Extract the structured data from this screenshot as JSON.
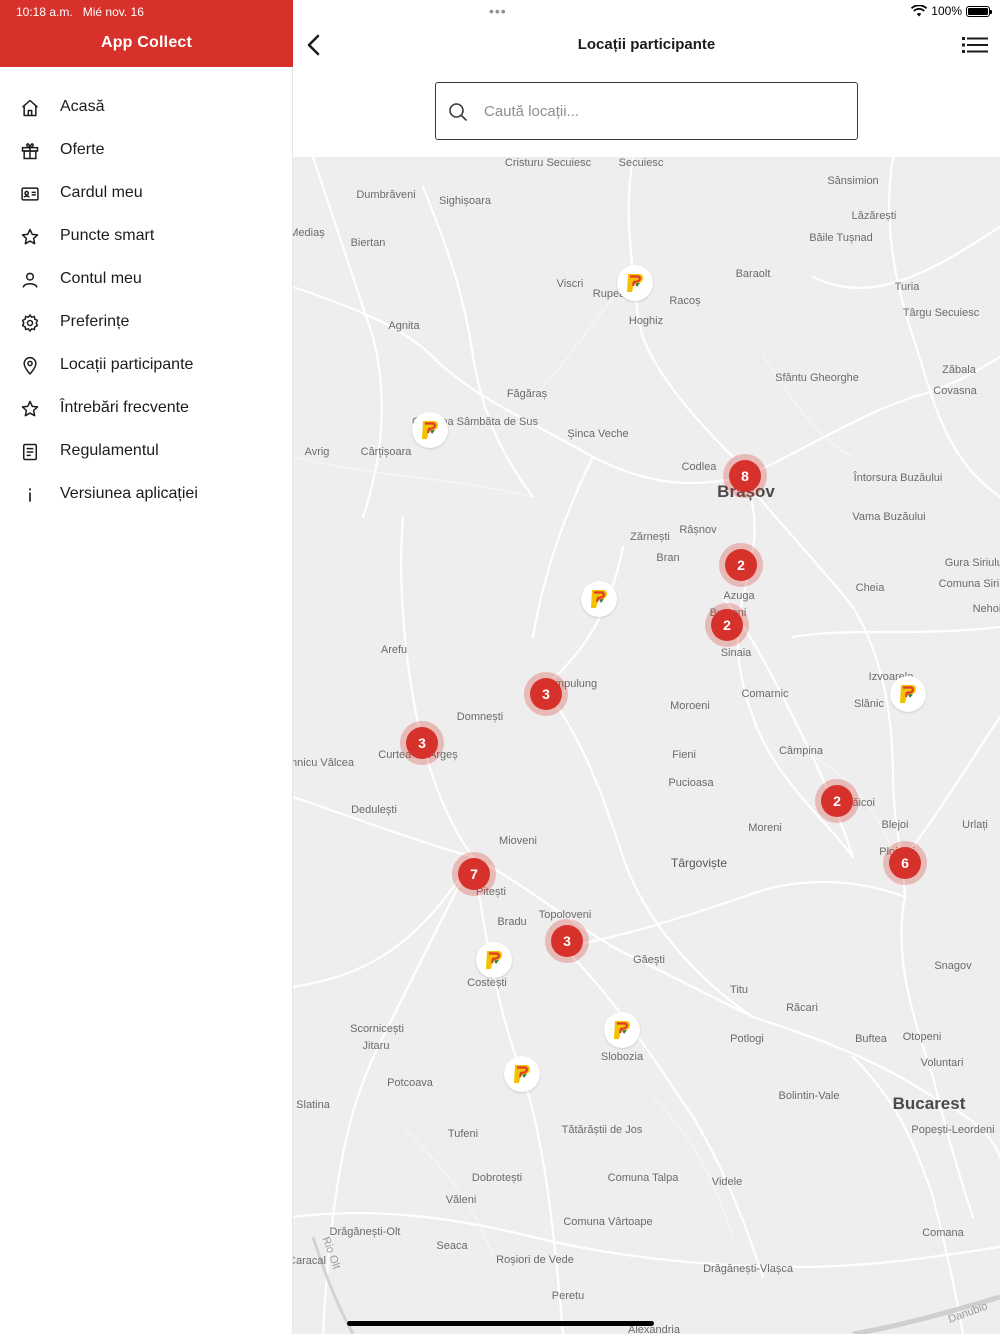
{
  "status": {
    "time": "10:18 a.m.",
    "date": "Mié nov. 16",
    "battery": "100%",
    "multitask_dots": "•••"
  },
  "colors": {
    "brand": "#d6312b",
    "text": "#1c1c1e",
    "muted": "#8e8e93",
    "map_bg": "#eeeeee"
  },
  "sidebar": {
    "title": "App Collect",
    "items": [
      {
        "label": "Acasă",
        "icon": "home-icon"
      },
      {
        "label": "Oferte",
        "icon": "gift-icon"
      },
      {
        "label": "Cardul meu",
        "icon": "card-icon"
      },
      {
        "label": "Puncte smart",
        "icon": "star-icon"
      },
      {
        "label": "Contul meu",
        "icon": "user-icon"
      },
      {
        "label": "Preferințe",
        "icon": "gear-icon"
      },
      {
        "label": "Locații participante",
        "icon": "location-pin-icon"
      },
      {
        "label": "Întrebări frecvente",
        "icon": "star-icon"
      },
      {
        "label": "Regulamentul",
        "icon": "document-icon"
      },
      {
        "label": "Versiunea aplicației",
        "icon": "info-icon"
      }
    ]
  },
  "header": {
    "title": "Locații participante",
    "back_icon": "chevron-left-icon",
    "list_icon": "list-icon"
  },
  "search": {
    "placeholder": "Caută locații...",
    "value": ""
  },
  "map": {
    "places": [
      "Cristuru Secuiesc",
      "Secuiesc",
      "Sânsimion",
      "Dumbrăveni",
      "Sighișoara",
      "Lăzărești",
      "Băile Tușnad",
      "Mediaș",
      "Biertan",
      "Baraolt",
      "Viscri",
      "Rupea",
      "Racoș",
      "Turia",
      "Hoghiz",
      "Târgu Secuiesc",
      "Agnita",
      "Zăbala",
      "Sfântu Gheorghe",
      "Covasna",
      "Făgăraș",
      "Comuna Sâmbăta de Sus",
      "Șinca Veche",
      "Avrig",
      "Cârțișoara",
      "Codlea",
      "Brașov",
      "Întorsura Buzăului",
      "Vama Buzăului",
      "Râșnov",
      "Zărnești",
      "Bran",
      "Gura Siriului",
      "Comuna Siriu",
      "Cheia",
      "Nehoiu",
      "Azuga",
      "Bușteni",
      "Sinaia",
      "Arefu",
      "Câmpulung",
      "Izvoarele",
      "Comarnic",
      "Moroeni",
      "Slănic",
      "Domnești",
      "Curtea de Argeș",
      "Râmnicu Vâlcea",
      "Fieni",
      "Câmpina",
      "Pucioasa",
      "Băicoi",
      "Dedulești",
      "Moreni",
      "Blejoi",
      "Urlați",
      "Mioveni",
      "Târgoviște",
      "Ploiești",
      "Pitești",
      "Topoloveni",
      "Bradu",
      "Găești",
      "Costești",
      "Snagov",
      "Titu",
      "Răcari",
      "Scornicești",
      "Jitaru",
      "Potlogi",
      "Buftea",
      "Otopeni",
      "Slobozia",
      "Voluntari",
      "Potcoava",
      "Bolintin-Vale",
      "Bucarest",
      "Slatina",
      "Popești-Leordeni",
      "Tufeni",
      "Tătărăștii de Jos",
      "Dobrotești",
      "Comuna Talpa",
      "Videle",
      "Văleni",
      "Drăgănești-Olt",
      "Comuna Vârtoape",
      "Comana",
      "Seaca",
      "Caracal",
      "Roșiori de Vede",
      "Drăgănești-Vlașca",
      "Peretu",
      "Alexandria",
      "Danubio",
      "Rio Olt"
    ],
    "clusters": [
      {
        "count": "8",
        "near": "Brașov"
      },
      {
        "count": "2",
        "near": "Predeal"
      },
      {
        "count": "2",
        "near": "Bușteni"
      },
      {
        "count": "3",
        "near": "Câmpulung"
      },
      {
        "count": "3",
        "near": "Curtea de Argeș"
      },
      {
        "count": "2",
        "near": "Băicoi"
      },
      {
        "count": "6",
        "near": "Ploiești"
      },
      {
        "count": "7",
        "near": "Pitești"
      },
      {
        "count": "3",
        "near": "Topoloveni"
      }
    ],
    "pins": [
      "Rupea",
      "Comuna Sâmbăta de Sus",
      "Rucăr",
      "Slănic",
      "Costești",
      "Slobozia",
      "Tufeni"
    ]
  }
}
